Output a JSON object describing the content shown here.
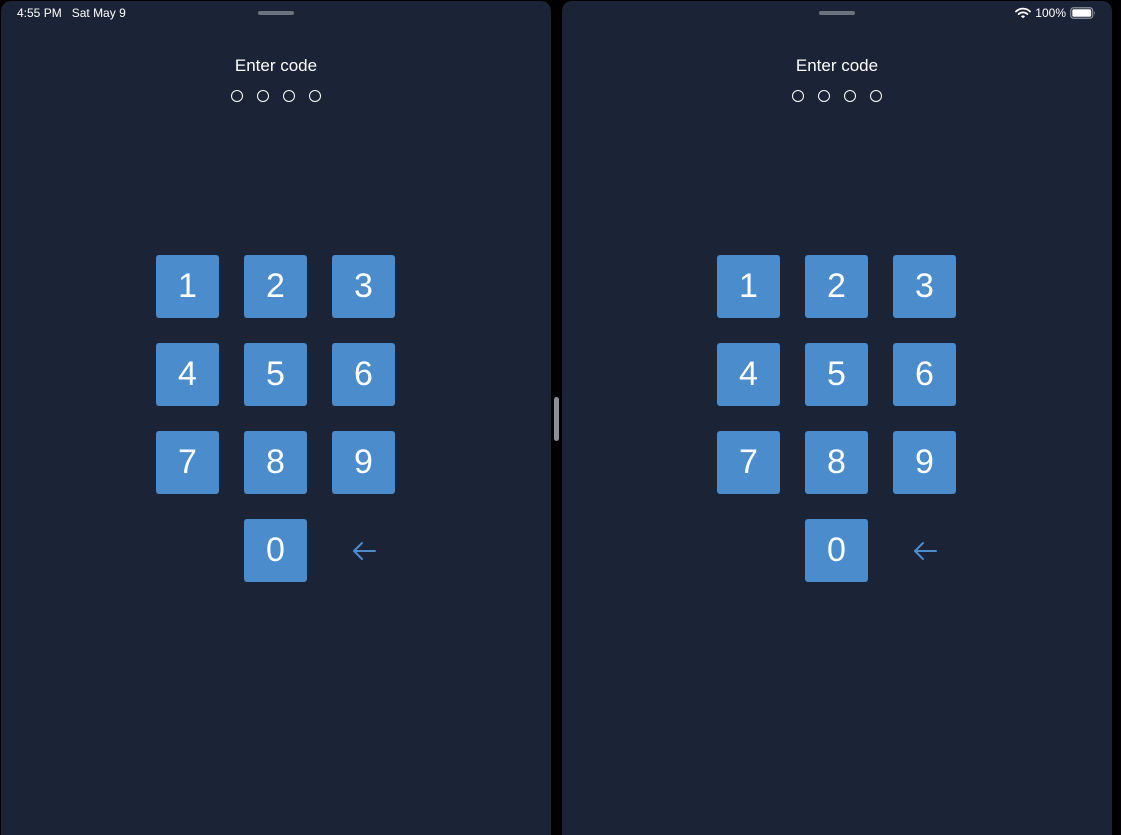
{
  "status_bar": {
    "time": "4:55 PM",
    "date": "Sat May 9",
    "battery_text": "100%",
    "icons": [
      "wifi-icon",
      "battery-icon"
    ]
  },
  "panes": [
    {
      "title": "Enter code",
      "code_length": 4,
      "entered_digits": 0,
      "keys": [
        "1",
        "2",
        "3",
        "4",
        "5",
        "6",
        "7",
        "8",
        "9",
        "0"
      ],
      "backspace_icon": "arrow-left-icon"
    },
    {
      "title": "Enter code",
      "code_length": 4,
      "entered_digits": 0,
      "keys": [
        "1",
        "2",
        "3",
        "4",
        "5",
        "6",
        "7",
        "8",
        "9",
        "0"
      ],
      "backspace_icon": "arrow-left-icon"
    }
  ],
  "colors": {
    "background": "#1b2436",
    "key": "#4a8ccc",
    "accent": "#4a8ccc",
    "text": "#ffffff"
  }
}
